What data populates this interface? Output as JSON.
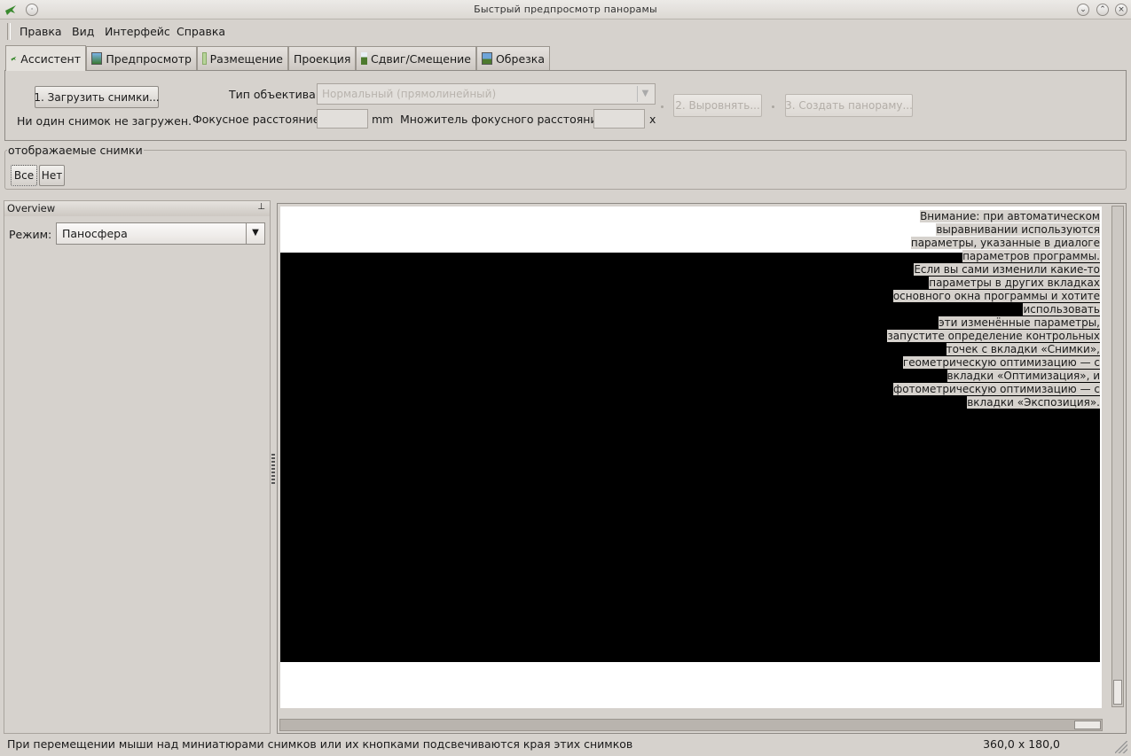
{
  "window": {
    "title": "Быстрый предпросмотр панорамы"
  },
  "menu": {
    "items": [
      "Правка",
      "Вид",
      "Интерфейс",
      "Справка"
    ]
  },
  "tabs": [
    {
      "label": "Ассистент",
      "icon": "assistant-icon"
    },
    {
      "label": "Предпросмотр",
      "icon": "gl-preview-icon"
    },
    {
      "label": "Размещение",
      "icon": "layout-icon"
    },
    {
      "label": "Проекция",
      "icon": ""
    },
    {
      "label": "Сдвиг/Смещение",
      "icon": "move-icon"
    },
    {
      "label": "Обрезка",
      "icon": "crop-icon"
    }
  ],
  "assistant": {
    "load_button": "1. Загрузить снимки...",
    "status": "Ни один снимок не загружен.",
    "lens_type_label": "Тип объектива:",
    "lens_type_value": "Нормальный (прямолинейный)",
    "focal_length_label": "Фокусное расстояние:",
    "focal_length_unit": "mm",
    "crop_factor_label": "Множитель фокусного расстояния:",
    "crop_factor_unit": "x",
    "align_button": "2. Выровнять...",
    "create_button": "3. Создать панораму..."
  },
  "displayed": {
    "title": "отображаемые снимки",
    "all_button": "Все",
    "none_button": "Нет"
  },
  "overview": {
    "title": "Overview",
    "mode_label": "Режим:",
    "mode_value": "Паносфера"
  },
  "preview": {
    "warning_lines": [
      "Внимание: при автоматическом",
      "выравнивании используются",
      "параметры, указанные в диалоге",
      "параметров программы.",
      "Если вы сами изменили какие-то",
      "параметры в других вкладках",
      "основного окна программы и хотите",
      "использовать",
      "эти изменённые параметры,",
      "запустите определение контрольных",
      "точек с вкладки «Снимки»,",
      "геометрическую оптимизацию — с",
      "вкладки «Оптимизация», и",
      "фотометрическую оптимизацию — с",
      "вкладки «Экспозиция»."
    ]
  },
  "status": {
    "message": "При перемещении мыши над миниатюрами снимков или их кнопками подсвечиваются края этих снимков",
    "coords": "360,0 x 180,0"
  }
}
